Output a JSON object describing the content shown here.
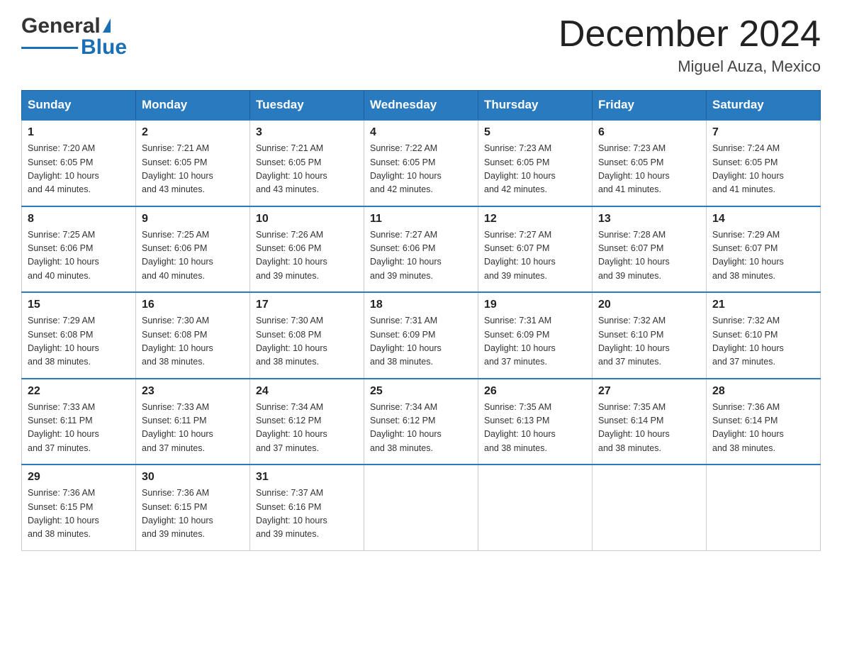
{
  "header": {
    "logo_general": "General",
    "logo_blue": "Blue",
    "title": "December 2024",
    "location": "Miguel Auza, Mexico"
  },
  "weekdays": [
    "Sunday",
    "Monday",
    "Tuesday",
    "Wednesday",
    "Thursday",
    "Friday",
    "Saturday"
  ],
  "weeks": [
    [
      {
        "day": "1",
        "info": "Sunrise: 7:20 AM\nSunset: 6:05 PM\nDaylight: 10 hours\nand 44 minutes."
      },
      {
        "day": "2",
        "info": "Sunrise: 7:21 AM\nSunset: 6:05 PM\nDaylight: 10 hours\nand 43 minutes."
      },
      {
        "day": "3",
        "info": "Sunrise: 7:21 AM\nSunset: 6:05 PM\nDaylight: 10 hours\nand 43 minutes."
      },
      {
        "day": "4",
        "info": "Sunrise: 7:22 AM\nSunset: 6:05 PM\nDaylight: 10 hours\nand 42 minutes."
      },
      {
        "day": "5",
        "info": "Sunrise: 7:23 AM\nSunset: 6:05 PM\nDaylight: 10 hours\nand 42 minutes."
      },
      {
        "day": "6",
        "info": "Sunrise: 7:23 AM\nSunset: 6:05 PM\nDaylight: 10 hours\nand 41 minutes."
      },
      {
        "day": "7",
        "info": "Sunrise: 7:24 AM\nSunset: 6:05 PM\nDaylight: 10 hours\nand 41 minutes."
      }
    ],
    [
      {
        "day": "8",
        "info": "Sunrise: 7:25 AM\nSunset: 6:06 PM\nDaylight: 10 hours\nand 40 minutes."
      },
      {
        "day": "9",
        "info": "Sunrise: 7:25 AM\nSunset: 6:06 PM\nDaylight: 10 hours\nand 40 minutes."
      },
      {
        "day": "10",
        "info": "Sunrise: 7:26 AM\nSunset: 6:06 PM\nDaylight: 10 hours\nand 39 minutes."
      },
      {
        "day": "11",
        "info": "Sunrise: 7:27 AM\nSunset: 6:06 PM\nDaylight: 10 hours\nand 39 minutes."
      },
      {
        "day": "12",
        "info": "Sunrise: 7:27 AM\nSunset: 6:07 PM\nDaylight: 10 hours\nand 39 minutes."
      },
      {
        "day": "13",
        "info": "Sunrise: 7:28 AM\nSunset: 6:07 PM\nDaylight: 10 hours\nand 39 minutes."
      },
      {
        "day": "14",
        "info": "Sunrise: 7:29 AM\nSunset: 6:07 PM\nDaylight: 10 hours\nand 38 minutes."
      }
    ],
    [
      {
        "day": "15",
        "info": "Sunrise: 7:29 AM\nSunset: 6:08 PM\nDaylight: 10 hours\nand 38 minutes."
      },
      {
        "day": "16",
        "info": "Sunrise: 7:30 AM\nSunset: 6:08 PM\nDaylight: 10 hours\nand 38 minutes."
      },
      {
        "day": "17",
        "info": "Sunrise: 7:30 AM\nSunset: 6:08 PM\nDaylight: 10 hours\nand 38 minutes."
      },
      {
        "day": "18",
        "info": "Sunrise: 7:31 AM\nSunset: 6:09 PM\nDaylight: 10 hours\nand 38 minutes."
      },
      {
        "day": "19",
        "info": "Sunrise: 7:31 AM\nSunset: 6:09 PM\nDaylight: 10 hours\nand 37 minutes."
      },
      {
        "day": "20",
        "info": "Sunrise: 7:32 AM\nSunset: 6:10 PM\nDaylight: 10 hours\nand 37 minutes."
      },
      {
        "day": "21",
        "info": "Sunrise: 7:32 AM\nSunset: 6:10 PM\nDaylight: 10 hours\nand 37 minutes."
      }
    ],
    [
      {
        "day": "22",
        "info": "Sunrise: 7:33 AM\nSunset: 6:11 PM\nDaylight: 10 hours\nand 37 minutes."
      },
      {
        "day": "23",
        "info": "Sunrise: 7:33 AM\nSunset: 6:11 PM\nDaylight: 10 hours\nand 37 minutes."
      },
      {
        "day": "24",
        "info": "Sunrise: 7:34 AM\nSunset: 6:12 PM\nDaylight: 10 hours\nand 37 minutes."
      },
      {
        "day": "25",
        "info": "Sunrise: 7:34 AM\nSunset: 6:12 PM\nDaylight: 10 hours\nand 38 minutes."
      },
      {
        "day": "26",
        "info": "Sunrise: 7:35 AM\nSunset: 6:13 PM\nDaylight: 10 hours\nand 38 minutes."
      },
      {
        "day": "27",
        "info": "Sunrise: 7:35 AM\nSunset: 6:14 PM\nDaylight: 10 hours\nand 38 minutes."
      },
      {
        "day": "28",
        "info": "Sunrise: 7:36 AM\nSunset: 6:14 PM\nDaylight: 10 hours\nand 38 minutes."
      }
    ],
    [
      {
        "day": "29",
        "info": "Sunrise: 7:36 AM\nSunset: 6:15 PM\nDaylight: 10 hours\nand 38 minutes."
      },
      {
        "day": "30",
        "info": "Sunrise: 7:36 AM\nSunset: 6:15 PM\nDaylight: 10 hours\nand 39 minutes."
      },
      {
        "day": "31",
        "info": "Sunrise: 7:37 AM\nSunset: 6:16 PM\nDaylight: 10 hours\nand 39 minutes."
      },
      null,
      null,
      null,
      null
    ]
  ]
}
